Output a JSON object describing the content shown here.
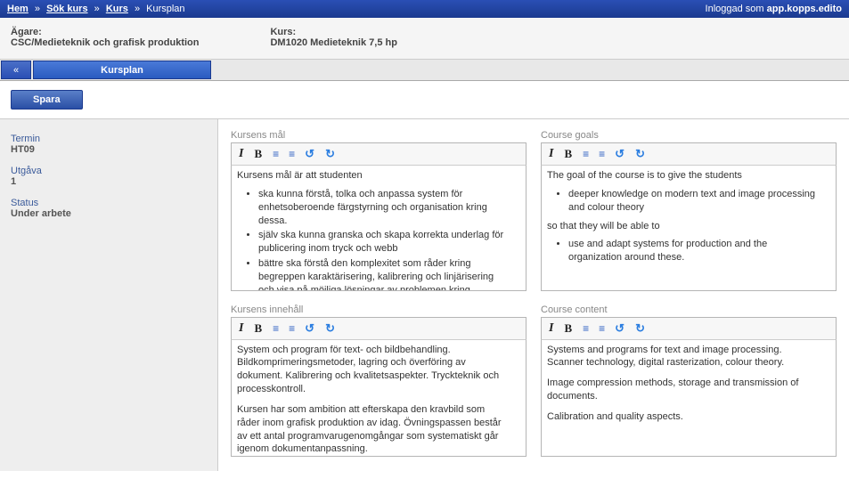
{
  "breadcrumb": {
    "home": "Hem",
    "search": "Sök kurs",
    "course": "Kurs",
    "current": "Kursplan"
  },
  "login": {
    "prefix": "Inloggad som ",
    "user": "app.kopps.edito"
  },
  "info": {
    "owner_label": "Ägare:",
    "owner_value": "CSC/Medieteknik och grafisk produktion",
    "course_label": "Kurs:",
    "course_value": "DM1020 Medieteknik 7,5 hp"
  },
  "tabs": {
    "back": "«",
    "current": "Kursplan"
  },
  "actions": {
    "save": "Spara"
  },
  "sidebar": {
    "term_label": "Termin",
    "term_value": "HT09",
    "edition_label": "Utgåva",
    "edition_value": "1",
    "status_label": "Status",
    "status_value": "Under arbete"
  },
  "editors": {
    "goals_sv": {
      "label": "Kursens mål",
      "intro": "Kursens mål är att studenten",
      "bullets": [
        "ska kunna förstå, tolka och anpassa system för enhetsoberoende färgstyrning och organisation kring dessa.",
        "själv ska kunna granska och skapa korrekta underlag för publicering inom tryck och webb",
        "bättre ska förstå den komplexitet som råder kring begreppen karaktärisering, kalibrering och linjärisering och visa på möjliga lösningar av problemen kring färgstyrning"
      ]
    },
    "goals_en": {
      "label": "Course goals",
      "intro": "The goal of the course is to give the students",
      "bullets1": [
        "deeper knowledge on modern text and image processing and colour theory"
      ],
      "mid": "so that they will be able to",
      "bullets2": [
        "use and adapt systems for production and the organization around these."
      ]
    },
    "content_sv": {
      "label": "Kursens innehåll",
      "p1": "System och program för text- och bildbehandling. Bildkomprimeringsmetoder, lagring och överföring av dokument. Kalibrering och kvalitetsaspekter. Tryckteknik och processkontroll.",
      "p2": "Kursen har som ambition att efterskapa den kravbild som råder inom grafisk produktion av idag. Övningspassen består av ett antal programvarugenomgångar som systematiskt går igenom dokumentanpassning."
    },
    "content_en": {
      "label": "Course content",
      "p1": "Systems and programs for text and image processing. Scanner technology, digital rasterization, colour theory.",
      "p2": "Image compression methods, storage and transmission of documents.",
      "p3": "Calibration and quality aspects."
    }
  }
}
